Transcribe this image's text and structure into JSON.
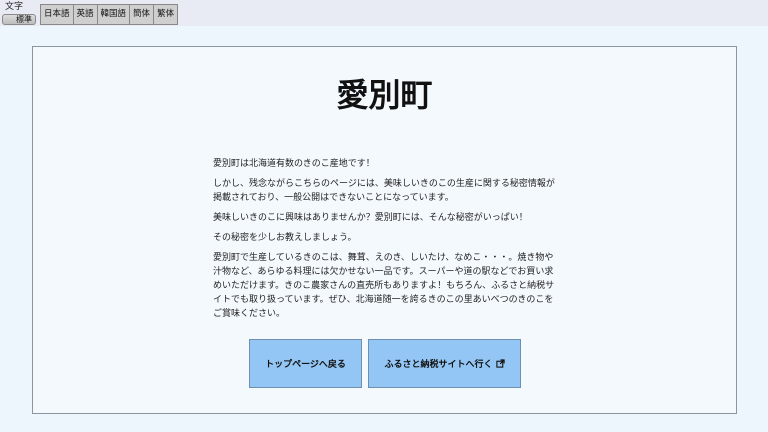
{
  "header": {
    "moji_label": "文字",
    "moji_button": "標準",
    "languages": [
      "日本語",
      "英語",
      "韓国語",
      "簡体",
      "繁体"
    ]
  },
  "main": {
    "title": "愛別町",
    "paragraphs": [
      "愛別町は北海道有数のきのこ産地です！",
      "しかし、残念ながらこちらのページには、美味しいきのこの生産に関する秘密情報が掲載されており、一般公開はできないことになっています。",
      "美味しいきのこに興味はありませんか？愛別町には、そんな秘密がいっぱい！",
      "その秘密を少しお教えしましょう。",
      "愛別町で生産しているきのこは、舞茸、えのき、しいたけ、なめこ・・・。焼き物や汁物など、あらゆる料理には欠かせない一品です。スーパーや道の駅などでお買い求めいただけます。きのこ農家さんの直売所もありますよ！もちろん、ふるさと納税サイトでも取り扱っています。ぜひ、北海道随一を誇るきのこの里あいべつのきのこをご賞味ください。"
    ],
    "buttons": {
      "top_page": "トップページへ戻る",
      "furusato": "ふるさと納税サイトへ行く"
    }
  },
  "icons": {
    "external_link": "external-link-icon"
  }
}
